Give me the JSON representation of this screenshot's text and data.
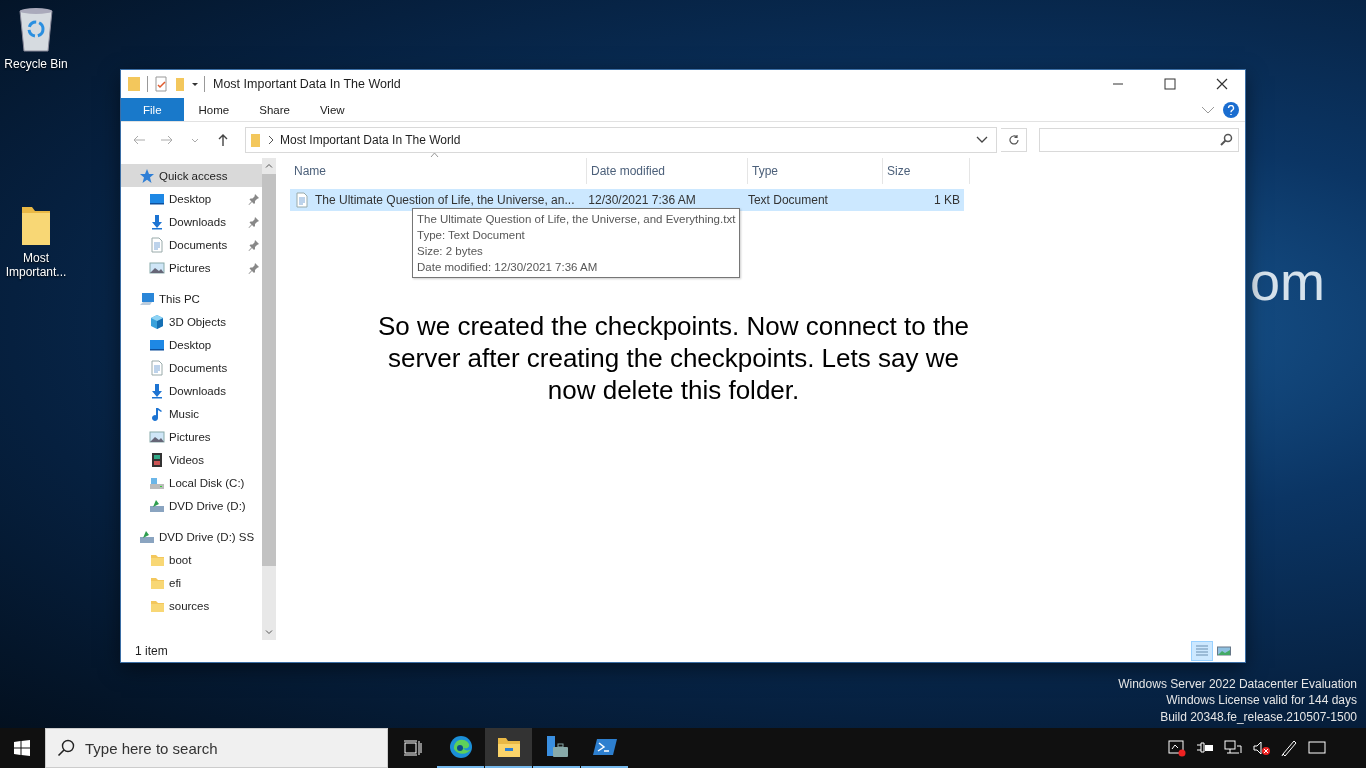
{
  "desktop_icons": [
    {
      "label": "Recycle Bin",
      "kind": "recycle"
    },
    {
      "label": "Most Important...",
      "kind": "folder"
    }
  ],
  "wallpaper_text": "om",
  "window": {
    "title": "Most Important Data In The World",
    "ribbon_tabs": [
      {
        "label": "File",
        "selected": true
      },
      {
        "label": "Home",
        "selected": false
      },
      {
        "label": "Share",
        "selected": false
      },
      {
        "label": "View",
        "selected": false
      }
    ],
    "address": "Most Important Data In The World",
    "nav_pane": [
      {
        "label": "Quick access",
        "kind": "star",
        "selected": true,
        "pinned": false,
        "children": [
          {
            "label": "Desktop",
            "kind": "monitor",
            "selected": false,
            "pinned": true
          },
          {
            "label": "Downloads",
            "kind": "download",
            "selected": false,
            "pinned": true
          },
          {
            "label": "Documents",
            "kind": "document",
            "selected": false,
            "pinned": true
          },
          {
            "label": "Pictures",
            "kind": "picture",
            "selected": false,
            "pinned": true
          }
        ]
      },
      {
        "label": "This PC",
        "kind": "computer",
        "selected": false,
        "pinned": false,
        "children": [
          {
            "label": "3D Objects",
            "kind": "cube",
            "selected": false,
            "pinned": false
          },
          {
            "label": "Desktop",
            "kind": "monitor",
            "selected": false,
            "pinned": false
          },
          {
            "label": "Documents",
            "kind": "document",
            "selected": false,
            "pinned": false
          },
          {
            "label": "Downloads",
            "kind": "download",
            "selected": false,
            "pinned": false
          },
          {
            "label": "Music",
            "kind": "music",
            "selected": false,
            "pinned": false
          },
          {
            "label": "Pictures",
            "kind": "picture",
            "selected": false,
            "pinned": false
          },
          {
            "label": "Videos",
            "kind": "film",
            "selected": false,
            "pinned": false
          },
          {
            "label": "Local Disk (C:)",
            "kind": "disk",
            "selected": false,
            "pinned": false
          },
          {
            "label": "DVD Drive (D:)",
            "kind": "dvd",
            "selected": false,
            "pinned": false
          }
        ]
      },
      {
        "label": "DVD Drive (D:) SS",
        "kind": "dvd",
        "selected": false,
        "pinned": false,
        "children": [
          {
            "label": "boot",
            "kind": "folder",
            "selected": false,
            "pinned": false
          },
          {
            "label": "efi",
            "kind": "folder",
            "selected": false,
            "pinned": false
          },
          {
            "label": "sources",
            "kind": "folder",
            "selected": false,
            "pinned": false
          }
        ]
      }
    ],
    "columns": [
      {
        "label": "Name",
        "sorted": true
      },
      {
        "label": "Date modified",
        "sorted": false
      },
      {
        "label": "Type",
        "sorted": false
      },
      {
        "label": "Size",
        "sorted": false
      }
    ],
    "rows": [
      {
        "name": "The Ultimate Question of Life, the Universe, an...",
        "date_modified": "12/30/2021 7:36 AM",
        "type": "Text Document",
        "size": "1 KB",
        "selected": true
      }
    ],
    "tooltip": [
      "The Ultimate Question of Life, the Universe, and Everything.txt",
      "Type: Text Document",
      "Size: 2 bytes",
      "Date modified: 12/30/2021 7:36 AM"
    ],
    "status_bar": "1 item",
    "views": [
      {
        "kind": "details",
        "selected": true
      },
      {
        "kind": "large_icons",
        "selected": false
      }
    ]
  },
  "caption": "So we created the checkpoints. Now connect to the server after creating the checkpoints. Lets say we now delete this folder.",
  "os_notice": [
    "Windows Server 2022 Datacenter Evaluation",
    "Windows License valid for 144 days",
    "Build 20348.fe_release.210507-1500"
  ],
  "taskbar": {
    "search": {
      "placeholder": "Type here to search"
    },
    "apps": [
      {
        "kind": "edge",
        "selected": false,
        "running": true
      },
      {
        "kind": "explorer",
        "selected": true,
        "running": true
      },
      {
        "kind": "server_manager",
        "selected": false,
        "running": true
      },
      {
        "kind": "powershell",
        "selected": false,
        "running": true
      }
    ]
  }
}
